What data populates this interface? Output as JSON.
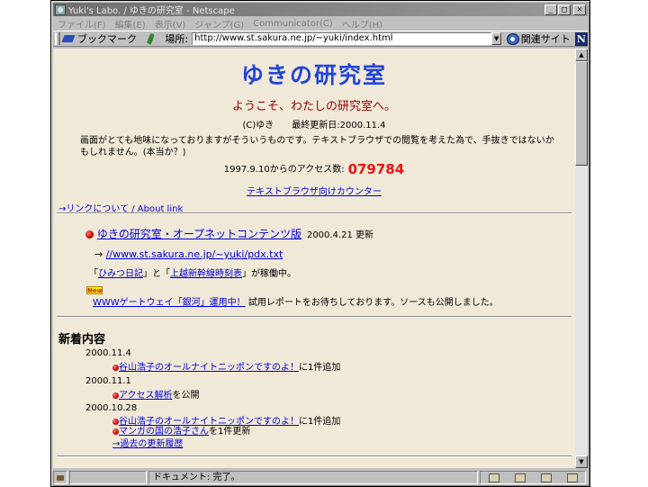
{
  "window": {
    "title": "Yuki's Labo. / ゆきの研究室 - Netscape",
    "buttons": {
      "minimize": "_",
      "maximize": "□",
      "close": "×"
    }
  },
  "menu": {
    "items": [
      "ファイル(F)",
      "編集(E)",
      "表示(V)",
      "ジャンプ(G)",
      "Communicator(C)",
      "ヘルプ(H)"
    ]
  },
  "toolbar": {
    "bookmarks_label": "ブックマーク",
    "location_label": "場所:",
    "url": "http://www.st.sakura.ne.jp/~yuki/index.html",
    "dropdown": "▼",
    "related_label": "関連サイト",
    "logo": "N"
  },
  "page": {
    "title": "ゆきの研究室",
    "welcome": "ようこそ、わたしの研究室へ。",
    "copyright": "(C)ゆき　　最終更新日:2000.11.4",
    "intro": "画面がとても地味になっておりますがそういうものです。テキストブラウザでの閲覧を考えた為で、手抜きではないかもしれません。(本当か？)",
    "counter_label": "1997.9.10からのアクセス数:",
    "counter_value": "079784",
    "text_counter_link": "テキストブラウザ向けカウンター",
    "about_link": "→リンクについて / About link",
    "opennet_link": "ゆきの研究室・オープネットコンテンツ版",
    "opennet_updated": "2000.4.21 更新",
    "pdx_arrow": "→",
    "pdx_url": "//www.st.sakura.ne.jp/~yuki/pdx.txt",
    "running": {
      "q1": "「",
      "diary_link": "ひみつ日記",
      "mid": "」と「",
      "timetable_link": "上越新幹線時刻表",
      "tail": "」が稼働中。"
    },
    "new_badge": "New",
    "gateway_link": "WWWゲートウェイ「銀河」運用中！",
    "gateway_text": "試用レポートをお待ちしております。ソースも公開しました。",
    "whats_new_heading": "新着内容",
    "news": [
      {
        "date": "2000.11.4",
        "items": [
          {
            "link": "谷山浩子のオールナイトニッポンですのよ！",
            "text": "に1件追加"
          }
        ]
      },
      {
        "date": "2000.11.1",
        "items": [
          {
            "link": "アクセス解析",
            "text": "を公開"
          }
        ]
      },
      {
        "date": "2000.10.28",
        "items": [
          {
            "link": "谷山浩子のオールナイトニッポンですのよ！",
            "text": "に1件追加"
          },
          {
            "link": "マンガの国の浩子さん",
            "text": "を1件更新"
          }
        ]
      }
    ],
    "past_link": "→過去の更新履歴"
  },
  "status": {
    "text": "ドキュメント: 完了。"
  }
}
